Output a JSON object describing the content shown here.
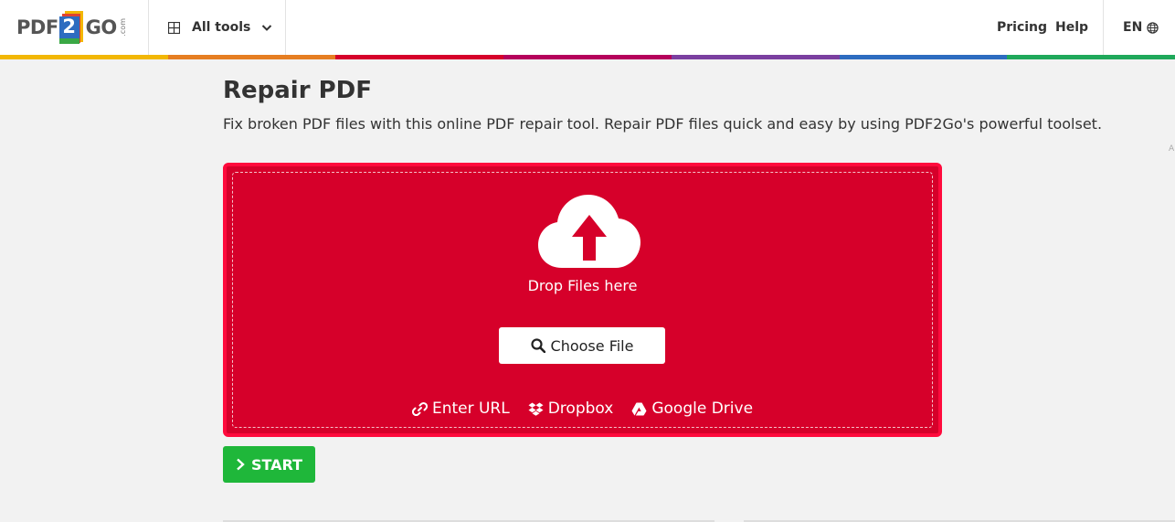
{
  "header": {
    "logo": {
      "left": "PDF",
      "middle": "2",
      "right": "GO",
      "suffix": ".com"
    },
    "all_tools_label": "All tools",
    "nav": {
      "pricing": "Pricing",
      "help": "Help"
    },
    "language": "EN"
  },
  "rainbow_colors": [
    "#f2b705",
    "#e67e22",
    "#d6002a",
    "#b5005b",
    "#7b3fa0",
    "#2d6cc0",
    "#1fa85a"
  ],
  "main": {
    "title": "Repair PDF",
    "description": "Fix broken PDF files with this online PDF repair tool. Repair PDF files quick and easy by using PDF2Go's powerful toolset.",
    "side_mark": "A"
  },
  "upload": {
    "drop_text": "Drop Files here",
    "choose_file": "Choose File",
    "sources": [
      {
        "label": "Enter URL",
        "icon": "link-icon"
      },
      {
        "label": "Dropbox",
        "icon": "dropbox-icon"
      },
      {
        "label": "Google Drive",
        "icon": "google-drive-icon"
      }
    ]
  },
  "start_label": "START",
  "colors": {
    "upload_bg": "#d6002a",
    "upload_border": "#ff0a3c",
    "start_bg": "#1fb73a",
    "page_bg": "#f2f2f2"
  }
}
